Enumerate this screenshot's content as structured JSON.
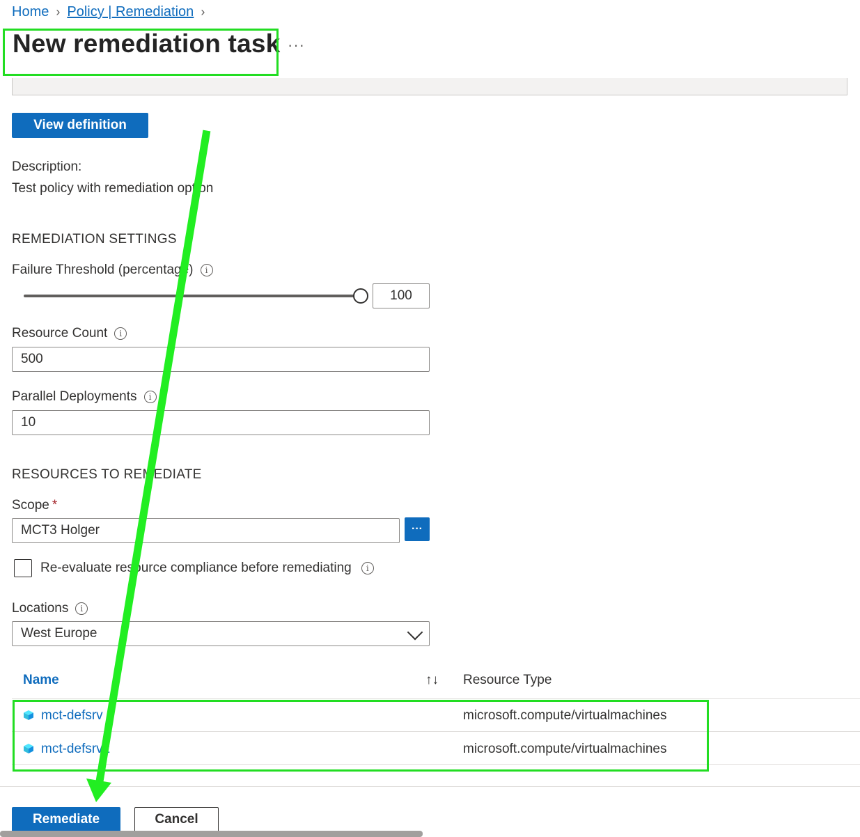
{
  "breadcrumb": {
    "home": "Home",
    "parent": "Policy | Remediation"
  },
  "page": {
    "title": "New remediation task",
    "more": "···"
  },
  "buttons": {
    "view_definition": "View definition",
    "remediate": "Remediate",
    "cancel": "Cancel",
    "scope_browse": "···"
  },
  "description": {
    "label": "Description:",
    "text": "Test policy with remediation option"
  },
  "settings": {
    "section": "REMEDIATION SETTINGS",
    "failure_threshold": {
      "label": "Failure Threshold (percentage)",
      "value": "100",
      "level_percent": 100
    },
    "resource_count": {
      "label": "Resource Count",
      "value": "500"
    },
    "parallel_deployments": {
      "label": "Parallel Deployments",
      "value": "10"
    }
  },
  "resources": {
    "section": "RESOURCES TO REMEDIATE",
    "scope": {
      "label": "Scope",
      "required": "*",
      "value": "MCT3 Holger"
    },
    "reevaluate": {
      "label": "Re-evaluate resource compliance before remediating",
      "checked": false
    },
    "locations": {
      "label": "Locations",
      "value": "West Europe"
    }
  },
  "table": {
    "columns": [
      "Name",
      "Resource Type"
    ],
    "sort_icon": "↑↓",
    "rows": [
      {
        "name": "mct-defsrv",
        "type": "microsoft.compute/virtualmachines"
      },
      {
        "name": "mct-defsrv2",
        "type": "microsoft.compute/virtualmachines"
      }
    ]
  },
  "icons": {
    "info": "info-icon",
    "chevron": "chevron-down-icon",
    "vm": "vm-cube-icon",
    "sort": "sort-icon"
  },
  "colors": {
    "accent": "#0f6cbd",
    "highlight": "#22dd22"
  }
}
